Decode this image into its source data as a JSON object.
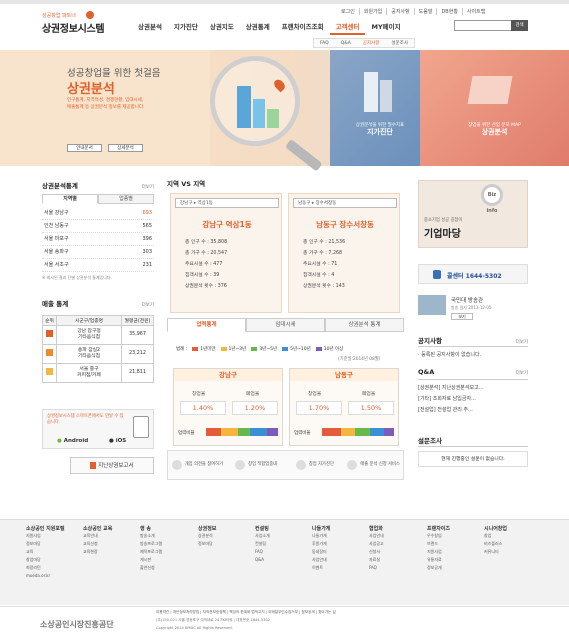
{
  "header": {
    "logo_small": "성공창업 파트너",
    "logo_main": "상권정보시스템",
    "util": [
      "로그인",
      "회원가입",
      "공지사항",
      "도움말",
      "DB현황",
      "사이트맵"
    ],
    "gnb": [
      "상권분석",
      "지가진단",
      "상권지도",
      "상권통계",
      "프랜차이즈조회",
      "고객센터",
      "MY페이지"
    ],
    "gnb_active": "고객센터",
    "search_button": "검색",
    "sub": [
      "FAQ",
      "Q&A",
      "공지사항",
      "설문조사"
    ],
    "sub_active": "공지사항"
  },
  "hero": {
    "title": "성공창업을 위한 첫걸음",
    "highlight": "상권분석",
    "desc": "인구통계, 지역특성, 경쟁현황, 임대시세, 매출통계 등 상권분석 정보를 제공합니다.",
    "btn1": "안내문서",
    "btn2": "상세분석",
    "tile1_sub": "상권분석을 위한 필수지표",
    "tile1": "지가진단",
    "tile2_sub": "창업을 위한 산업 분포 MAP",
    "tile2": "상권분석"
  },
  "stats": {
    "title": "상권분석통계",
    "more": "더보기",
    "tabs": [
      "지역별",
      "업종별"
    ],
    "rank": [
      {
        "name": "서울 강남구",
        "value": "693"
      },
      {
        "name": "인천 남동구",
        "value": "565"
      },
      {
        "name": "서울 마포구",
        "value": "396"
      },
      {
        "name": "서울 송파구",
        "value": "303"
      },
      {
        "name": "서울 서초구",
        "value": "231"
      }
    ],
    "note": "※ 최시된 결과 단별 상권분석 통계입니다."
  },
  "sales": {
    "title": "매출 통계",
    "more": "더보기",
    "headers": [
      "순위",
      "시군구/업종명",
      "월평균(천원)"
    ],
    "rows": [
      {
        "rank": "",
        "area": "강남 압구정",
        "biz": "기타음식점",
        "value": "35,967"
      },
      {
        "rank": "",
        "area": "송파 잠실2",
        "biz": "기타음식점",
        "value": "23,212"
      },
      {
        "rank": "",
        "area": "서울 중구",
        "biz": "커피점/카페",
        "value": "21,811"
      }
    ]
  },
  "app": {
    "text": "상권정보시스템 스마트폰에서도 만날 수 있습니다.",
    "android": "Android",
    "ios": "iOS"
  },
  "report_button": "지난상권보고서",
  "compare": {
    "title": "지역 VS 지역",
    "left": {
      "select": "강남구 ▸ 역삼1동",
      "name": "강남구 역삼1동",
      "items": [
        "총 인구 수 : 35,808",
        "총 가구 수 : 20,547",
        "주요시설 수 : 477",
        "집객시설 수 : 39",
        "상권분석 횟수 : 376"
      ]
    },
    "right": {
      "select": "남동구 ▸ 장수서창동",
      "name": "남동구 장수서창동",
      "items": [
        "총 인구 수 : 21,536",
        "총 가구 수 : 7,268",
        "주요시설 수 : 71",
        "집객시설 수 : 4",
        "상권분석 횟수 : 143"
      ]
    },
    "tabs": [
      "업력통계",
      "임대시세",
      "상권분석 통계"
    ],
    "legend_label": "범례 :",
    "legend": [
      {
        "label": "1년미만",
        "color": "#e45c3a"
      },
      {
        "label": "1년~3년",
        "color": "#f4b63f"
      },
      {
        "label": "3년~5년",
        "color": "#66b94a"
      },
      {
        "label": "5년~10년",
        "color": "#3b8fd4"
      },
      {
        "label": "10년 이상",
        "color": "#7d5cb8"
      }
    ],
    "base": "(기준일:2014년 08월)",
    "cards": [
      {
        "title": "강남구",
        "l1": "창업율",
        "l2": "폐업율",
        "v1": "1.40%",
        "v2": "1.20%",
        "rate": "업력비율"
      },
      {
        "title": "남동구",
        "l1": "창업율",
        "l2": "폐업율",
        "v1": "1.70%",
        "v2": "1.50%",
        "rate": "업력비율"
      }
    ],
    "quick": [
      "개업 의견을 참여하기",
      "창업 적합업종내",
      "창업 자가진단",
      "매출 분석 신청 서비스"
    ]
  },
  "right": {
    "banner_text": "중소기업 성공 길잡이",
    "banner_main": "기업마당",
    "banner_badge": "Biz info",
    "callcenter": "콜센터 1644-5302",
    "news_title": "국민대 방송관",
    "news_sub": "방송 일자 2013-12-05",
    "news_more": "보기",
    "notice_title": "공지사항",
    "notice_more": "더보기",
    "notice_items": [
      "· 등록된 공지사항이 없습니다."
    ],
    "qa_title": "Q&A",
    "qa_more": "더보기",
    "qa_items": [
      "[상권분석] 지난상권분석보고...",
      "[기타] 조회자료 남입금자...",
      "[전설업] 전설업 관리 주..."
    ],
    "survey_title": "설문조사",
    "survey_text": "현재 진행중인 설문이 없습니다."
  },
  "footer": {
    "cols": [
      {
        "h": "소상공인 지원포털",
        "items": [
          "지원사업",
          "정보마당",
          "교육",
          "창업마당",
          "희망리턴",
          "mueda.or.kr"
        ]
      },
      {
        "h": "소상공인 교육",
        "items": [
          "교육안내",
          "교육신청",
          "교육현장"
        ]
      },
      {
        "h": "행 송",
        "items": [
          "방송소개",
          "방송프로그램",
          "제작프로그램",
          "게시판",
          "출연신청"
        ]
      },
      {
        "h": "상권정보",
        "items": [
          "상권분석",
          "정보마당"
        ]
      },
      {
        "h": "컨설팅",
        "items": [
          "사업소개",
          "컨설팅",
          "FAQ",
          "Q&A"
        ]
      },
      {
        "h": "나들가게",
        "items": [
          "나들가게",
          "후원가게",
          "동네장터",
          "사업안내",
          "이벤트"
        ]
      },
      {
        "h": "협업화",
        "items": [
          "사업안내",
          "사업공고",
          "신청서",
          "자료실",
          "FAQ"
        ]
      },
      {
        "h": "프랜차이즈",
        "items": [
          "우수창업",
          "브랜드",
          "지원사업",
          "유통자료",
          "정보공개"
        ]
      },
      {
        "h": "시니어창업",
        "items": [
          "창업",
          "비즈플러스",
          "커뮤니티"
        ]
      }
    ],
    "links": "이용약관 | 개인정보처리방침 | 저작권보호정책 | 책임의 한계와 법적고지 | 이메일무단수집거부 | 정보공개 | 찾아가는 길",
    "address": "(우)150-021 서울 영등포구 여의대로 24 FKI타워 | 대표번호 1644-5302",
    "copyright": "Copyright 2014 KMDC All Rights Reserved.",
    "org": "소상공인시장진흥공단"
  }
}
